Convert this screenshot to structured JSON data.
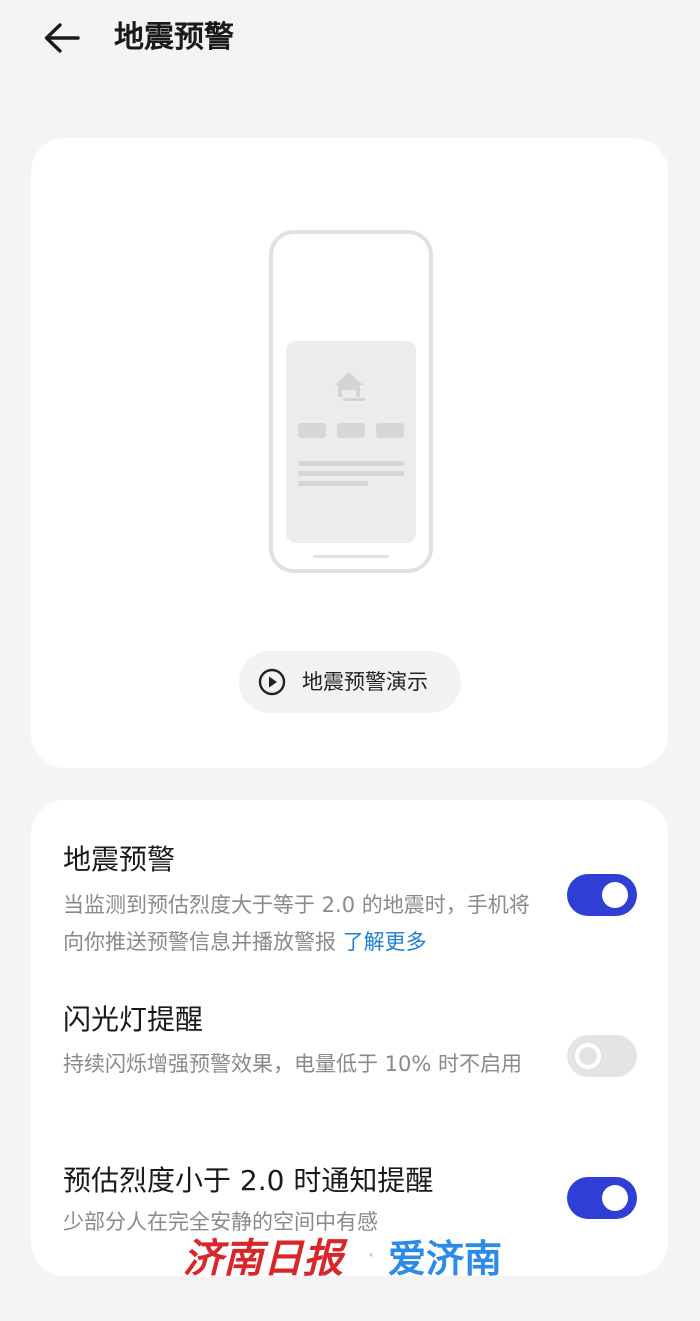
{
  "header": {
    "back_icon": "arrow-left-icon",
    "title": "地震预警"
  },
  "demo": {
    "illustration_icon": "house-icon",
    "button_icon": "play-circle-icon",
    "button_label": "地震预警演示"
  },
  "settings": [
    {
      "title": "地震预警",
      "description": "当监测到预估烈度大于等于 2.0 的地震时，手机将向你推送预警信息并播放警报 ",
      "link": "了解更多",
      "enabled": true
    },
    {
      "title": "闪光灯提醒",
      "description": "持续闪烁增强预警效果，电量低于 10% 时不启用",
      "enabled": false
    },
    {
      "title": "预估烈度小于 2.0 时通知提醒",
      "description": "少部分人在完全安静的空间中有感",
      "enabled": true
    }
  ],
  "watermark": {
    "left_text": "济南日报",
    "separator": "·",
    "right_text": "爱济南"
  },
  "colors": {
    "accent": "#2f3fd6",
    "link": "#1d7fd1",
    "watermark_red": "#d9262b",
    "watermark_blue": "#2a8be8",
    "background": "#f4f4f4"
  }
}
